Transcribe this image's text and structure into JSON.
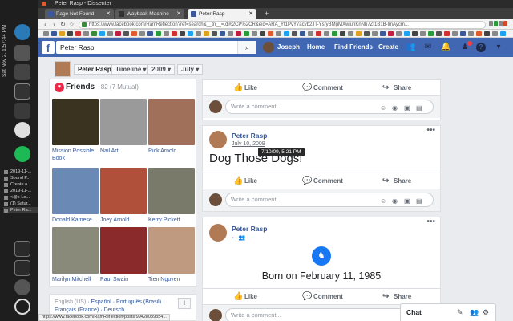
{
  "os": {
    "clock": "Sat Nov 2, 1:57:44 PM",
    "tasks": [
      "2019-11-...",
      "Sound P...",
      "Create a...",
      "2019-11-...",
      "<@s-Le...",
      "(1) Satur...",
      "Peter Ra..."
    ]
  },
  "browser": {
    "window_title": "Peter Rasp - Dissenter",
    "tabs": [
      {
        "label": "Page Not Found",
        "active": false
      },
      {
        "label": "Wayback Machine",
        "active": false
      },
      {
        "label": "Peter Rasp",
        "active": true
      }
    ],
    "new_tab": "+",
    "url": "https://www.facebook.com/RamReflection?ref=search&__tn__=,d%2CP%2CR&eid=ARA_Yt1PvY7acvb2JT-YsryBMgMXwiunKnNb7Zt1B1B-lmAycm...",
    "status_url": "https://www.facebook.com/RamReflection/posts/99428039354..."
  },
  "fb": {
    "logo": "f",
    "search_value": "Peter Rasp",
    "profile_name": "Joseph",
    "nav": [
      "Home",
      "Find Friends",
      "Create"
    ]
  },
  "timeline": {
    "name": "Peter Rasp",
    "section": "Timeline ▾",
    "year": "2009 ▾",
    "month": "July ▾"
  },
  "friends": {
    "title": "Friends",
    "count": "· 82 (7 Mutual)",
    "items": [
      {
        "name": "Mission Possible Book",
        "color": "#3a3320"
      },
      {
        "name": "Nail Art",
        "color": "#9a9a9a"
      },
      {
        "name": "Rick Arnold",
        "color": "#a0705a"
      },
      {
        "name": "Donald Kamese",
        "color": "#6a8ab5"
      },
      {
        "name": "Joey Arnold",
        "color": "#b0503a"
      },
      {
        "name": "Kerry Pickett",
        "color": "#7a7a6a"
      },
      {
        "name": "Marilyn Mitchell",
        "color": "#8a8a7a"
      },
      {
        "name": "Paul Swain",
        "color": "#8a2a2a"
      },
      {
        "name": "Tien Nguyen",
        "color": "#c09a80"
      }
    ]
  },
  "languages": {
    "current": "English (US)",
    "line1_links": "· Español · Português (Brasil)",
    "line2": "Français (France) · Deutsch",
    "add": "+"
  },
  "actions": {
    "like": "Like",
    "comment": "Comment",
    "share": "Share"
  },
  "comment_placeholder": "Write a comment...",
  "post1": {
    "author": "Peter Rasp",
    "date": "July 10, 2009",
    "tooltip": "7/10/09, 5:21 PM",
    "text": "Dog Those Dogs!",
    "more": "•••"
  },
  "post2": {
    "author": "Peter Rasp",
    "event": "Born on February 11, 1985",
    "more": "•••"
  },
  "chat": {
    "title": "Chat"
  }
}
